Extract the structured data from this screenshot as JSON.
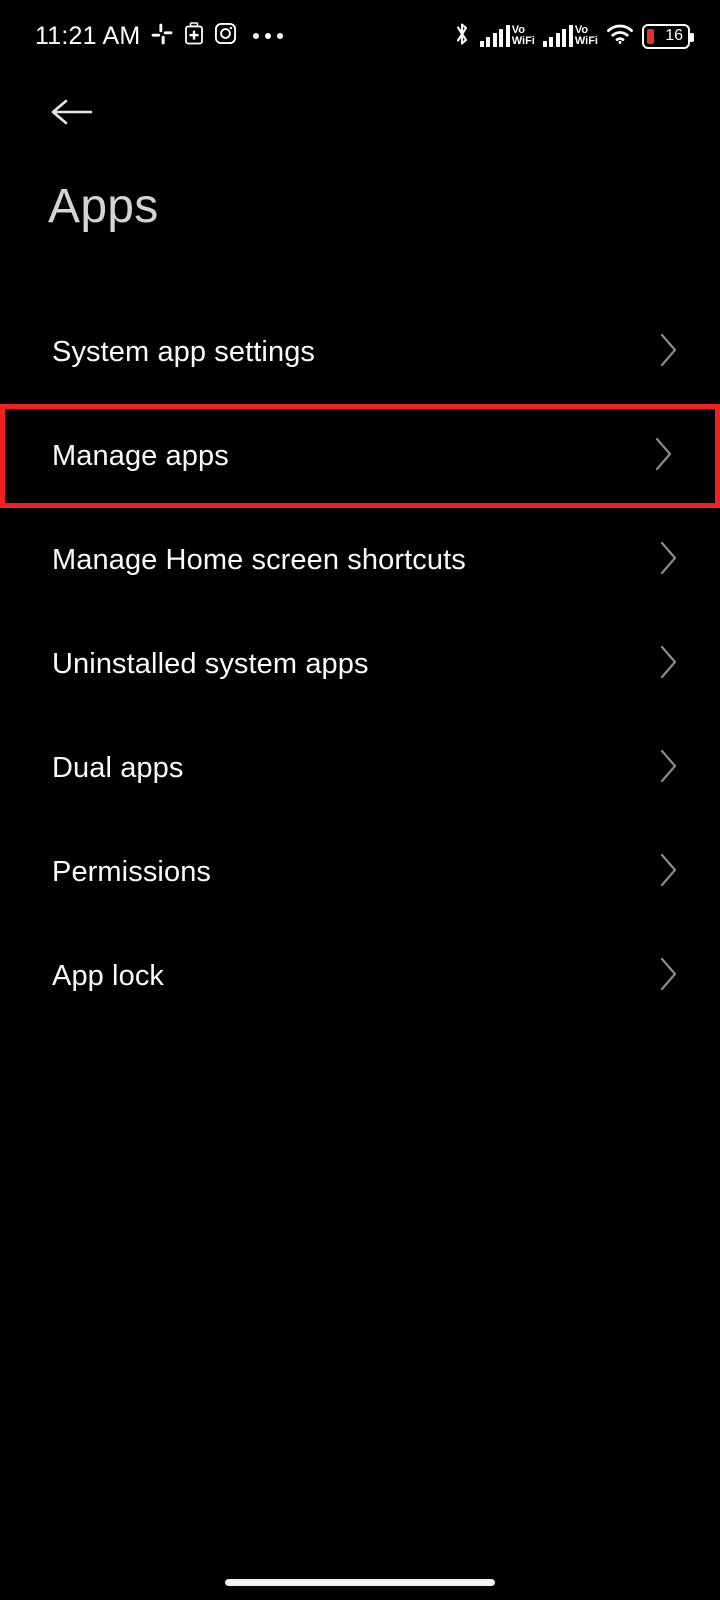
{
  "status_bar": {
    "time": "11:21 AM",
    "left_icons": [
      {
        "name": "slack-icon",
        "label": "Slack"
      },
      {
        "name": "medical-kit-icon",
        "label": "Health"
      },
      {
        "name": "instagram-icon",
        "label": "Instagram"
      },
      {
        "name": "more-notifications-icon",
        "label": "More notifications"
      }
    ],
    "right_icons": [
      {
        "name": "bluetooth-icon",
        "label": "Bluetooth"
      },
      {
        "name": "signal-icon-sim1",
        "label": "Signal SIM 1",
        "bars": 5
      },
      {
        "name": "vowifi-label-sim1",
        "line1": "Vo",
        "line2": "WiFi"
      },
      {
        "name": "signal-icon-sim2",
        "label": "Signal SIM 2",
        "bars": 5
      },
      {
        "name": "vowifi-label-sim2",
        "line1": "Vo",
        "line2": "WiFi"
      },
      {
        "name": "wifi-icon",
        "label": "Wi-Fi"
      }
    ],
    "battery": {
      "level": "16",
      "fill_color": "#e8312a",
      "outline_color": "#ffffff"
    }
  },
  "header": {
    "back_label": "Back",
    "title": "Apps"
  },
  "list": {
    "items": [
      {
        "label": "System app settings",
        "highlighted": false,
        "chevron": "chevron-right-icon"
      },
      {
        "label": "Manage apps",
        "highlighted": true,
        "chevron": "chevron-right-icon"
      },
      {
        "label": "Manage Home screen shortcuts",
        "highlighted": false,
        "chevron": "chevron-right-icon"
      },
      {
        "label": "Uninstalled system apps",
        "highlighted": false,
        "chevron": "chevron-right-icon"
      },
      {
        "label": "Dual apps",
        "highlighted": false,
        "chevron": "chevron-right-icon"
      },
      {
        "label": "Permissions",
        "highlighted": false,
        "chevron": "chevron-right-icon"
      },
      {
        "label": "App lock",
        "highlighted": false,
        "chevron": "chevron-right-icon"
      }
    ]
  },
  "highlight": {
    "color": "#f32020",
    "target": "Manage apps"
  },
  "navigation": {
    "gesture_bar_label": "Home gesture bar"
  },
  "theme": {
    "background": "#000000",
    "text_primary": "#fafafa",
    "text_title": "#d4d4d4",
    "chevron": "#8a8a8a"
  }
}
